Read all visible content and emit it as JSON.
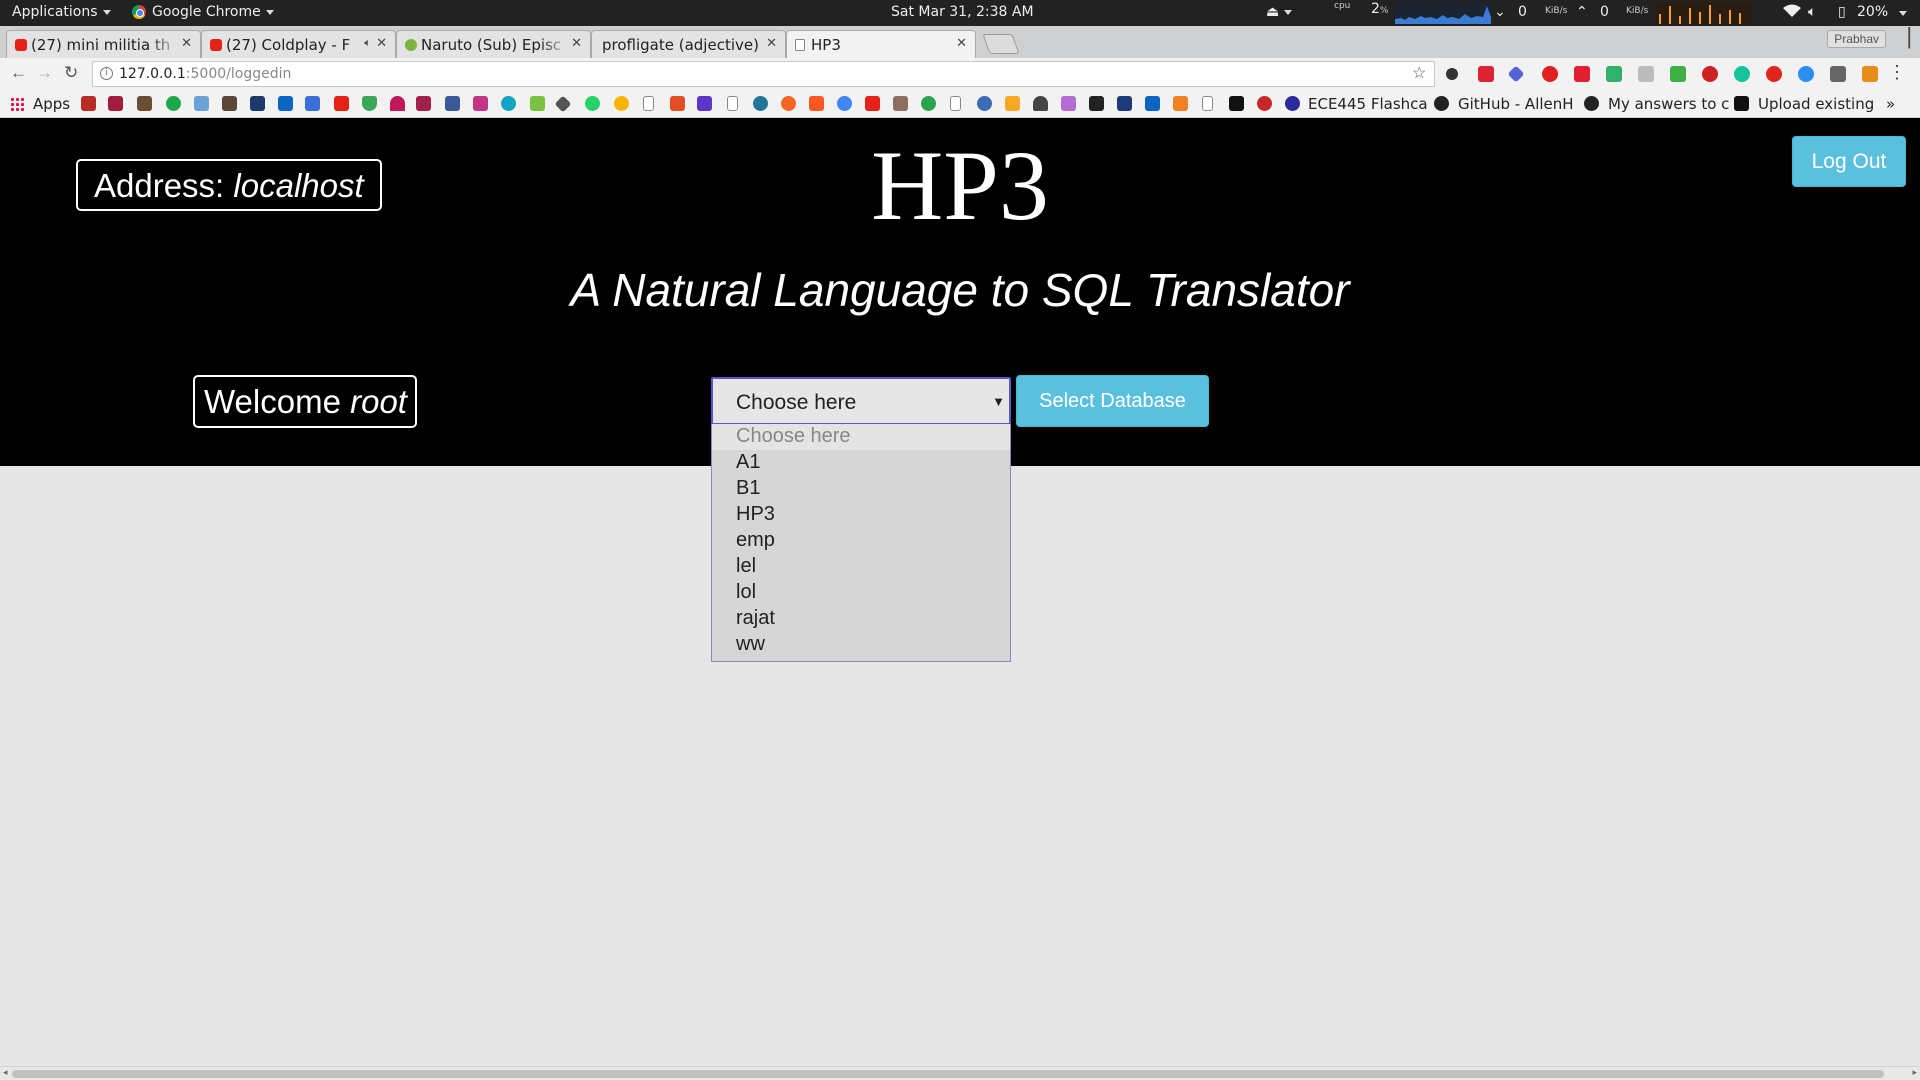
{
  "os_panel": {
    "applications": "Applications",
    "active_app": "Google Chrome",
    "clock": "Sat Mar 31,  2:38 AM",
    "cpu_label": "cpu",
    "cpu_value": "2",
    "cpu_unit": "%",
    "net_down": "0",
    "net_down_unit": "KiB/s",
    "net_up": "0",
    "net_up_unit": "KiB/s",
    "battery": "20%"
  },
  "tabs": [
    {
      "title": "(27) mini militia th",
      "favicon": "youtube-icon",
      "color": "#e62117"
    },
    {
      "title": "(27) Coldplay - F",
      "favicon": "youtube-icon",
      "color": "#e62117"
    },
    {
      "title": "Naruto (Sub) Episc",
      "favicon": "site-icon",
      "color": "#7cb342"
    },
    {
      "title": "profligate (adjective)",
      "favicon": "none",
      "color": ""
    },
    {
      "title": "HP3",
      "favicon": "page-icon",
      "color": "#888888"
    }
  ],
  "profile_name": "Prabhav",
  "address_bar": {
    "host": "127.0.0.1",
    "path": ":5000/loggedin"
  },
  "bookmarks": {
    "apps": "Apps",
    "ece445": "ECE445 Flashca",
    "github": "GitHub - AllenH",
    "answers": "My answers to c",
    "upload": "Upload existing",
    "more": "»"
  },
  "header": {
    "address_label": "Address: ",
    "address_value": "localhost",
    "title": "HP3",
    "subtitle": "A Natural Language to SQL Translator",
    "logout": "Log Out",
    "welcome_label": "Welcome ",
    "welcome_user": "root"
  },
  "database_select": {
    "selected": "Choose here",
    "button": "Select Database",
    "options": [
      "Choose here",
      "A1",
      "B1",
      "HP3",
      "emp",
      "lel",
      "lol",
      "rajat",
      "ww"
    ]
  },
  "colors": {
    "accent_button": "#5bc0de",
    "hero_bg": "#000000",
    "page_bg": "#e6e6e6"
  }
}
